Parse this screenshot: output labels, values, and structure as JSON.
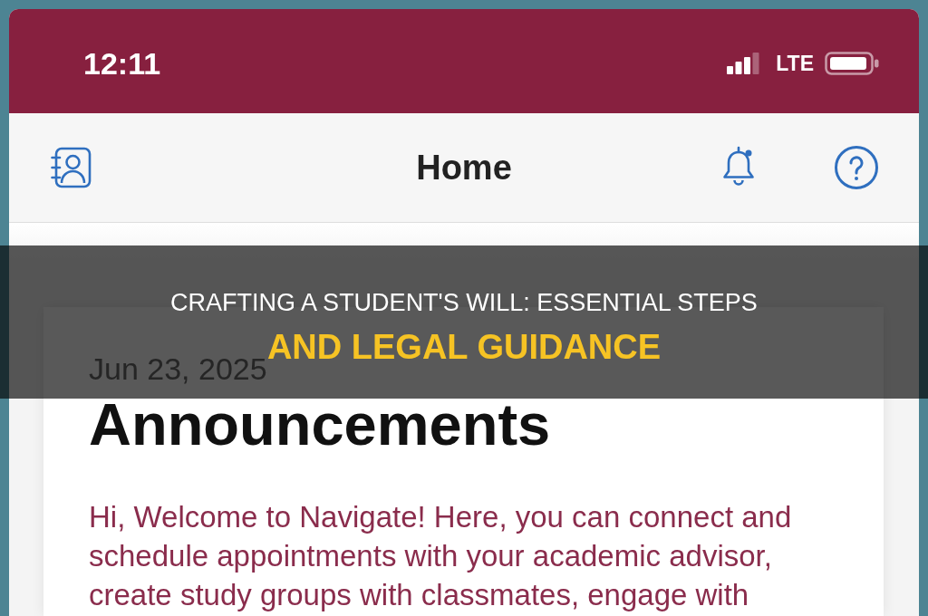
{
  "status_bar": {
    "time": "12:11",
    "network": "LTE"
  },
  "nav_bar": {
    "title": "Home"
  },
  "announcement": {
    "date": "Jun 23, 2025",
    "heading": "Announcements",
    "body": "Hi, Welcome to Navigate! Here, you can connect and schedule appointments with your academic advisor, create study groups with classmates, engage with"
  },
  "banner": {
    "title": "CRAFTING A STUDENT'S WILL: ESSENTIAL STEPS",
    "highlight": "AND LEGAL GUIDANCE"
  }
}
